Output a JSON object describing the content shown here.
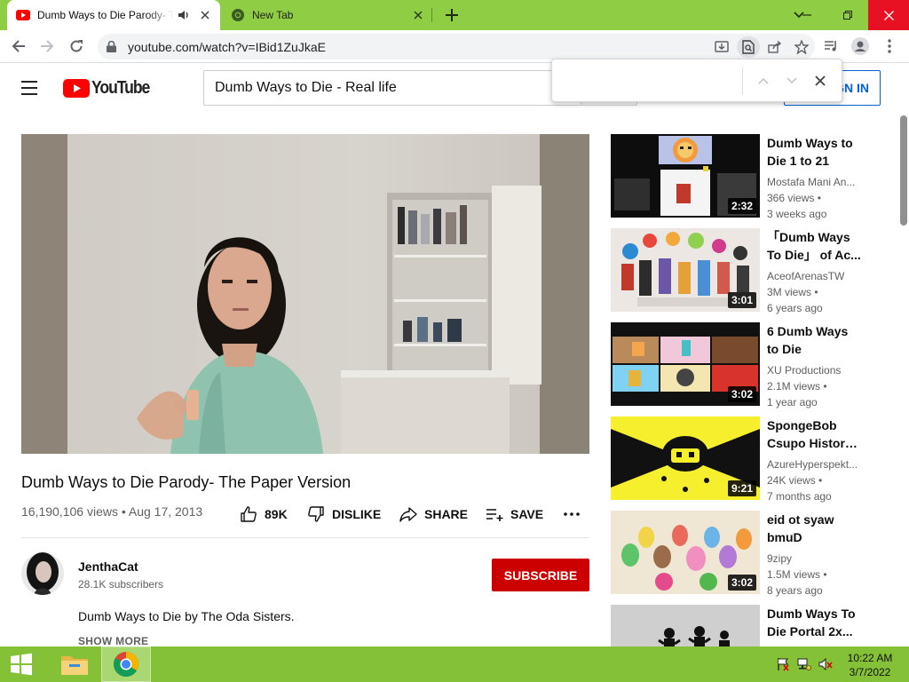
{
  "browser": {
    "tabs": [
      {
        "title": "Dumb Ways to Die Parody- The Paper Version - YouTube",
        "active": true,
        "favicon": "youtube-icon",
        "audio": true
      },
      {
        "title": "New Tab",
        "active": false,
        "favicon": "chrome-icon"
      }
    ],
    "url": "youtube.com/watch?v=IBid1ZuJkaE",
    "accent": "#8fce44",
    "find_query": ""
  },
  "youtube": {
    "logo_text": "YouTube",
    "search_query": "Dumb Ways to Die - Real life",
    "sign_in_label": "SIGN IN",
    "video": {
      "title": "Dumb Ways to Die Parody- The Paper Version",
      "stats": "16,190,106 views • Aug 17, 2013",
      "like_count": "89K",
      "dislike_label": "DISLIKE",
      "share_label": "SHARE",
      "save_label": "SAVE",
      "channel": "JenthaCat",
      "subscribers": "28.1K subscribers",
      "subscribe_label": "SUBSCRIBE",
      "description": "Dumb Ways to Die by The Oda Sisters.",
      "show_more_label": "SHOW MORE"
    },
    "recommendations": [
      {
        "title_lines": [
          "Dumb Ways to",
          "Die 1 to 21"
        ],
        "channel": "Mostafa Mani An...",
        "views": "366 views",
        "age": "3 weeks ago",
        "duration": "2:32"
      },
      {
        "title_lines": [
          "「Dumb Ways",
          "To Die」 of Ac..."
        ],
        "channel": "AceofArenasTW",
        "views": "3M views",
        "age": "6 years ago",
        "duration": "3:01"
      },
      {
        "title_lines": [
          "6 Dumb Ways",
          "to Die"
        ],
        "channel": "XU Productions",
        "views": "2.1M views",
        "age": "1 year ago",
        "duration": "3:02"
      },
      {
        "title_lines": [
          "SpongeBob",
          "Csupo History..."
        ],
        "channel": "AzureHyperspekt...",
        "views": "24K views",
        "age": "7 months ago",
        "duration": "9:21"
      },
      {
        "title_lines": [
          "eid ot syaw",
          "bmuD"
        ],
        "channel": "9zipy",
        "views": "1.5M views",
        "age": "8 years ago",
        "duration": "3:02"
      },
      {
        "title_lines": [
          "Dumb Ways To",
          "Die Portal 2x..."
        ],
        "channel": "",
        "views": "",
        "age": "",
        "duration": ""
      }
    ]
  },
  "taskbar": {
    "time": "10:22 AM",
    "date": "3/7/2022",
    "color": "#84c136"
  }
}
